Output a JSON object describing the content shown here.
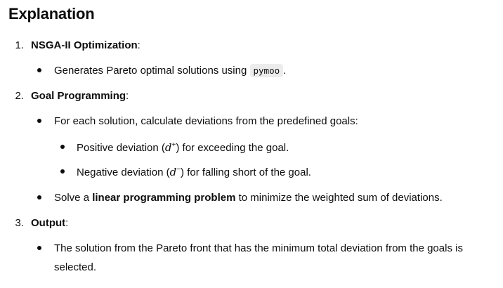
{
  "heading": "Explanation",
  "list": {
    "items": [
      {
        "number": "1.",
        "title": "NSGA-II Optimization",
        "suffix": ":",
        "bullets": [
          {
            "text_before": "Generates Pareto optimal solutions using",
            "code": "pymoo",
            "text_after": "."
          }
        ]
      },
      {
        "number": "2.",
        "title": "Goal Programming",
        "suffix": ":",
        "bullets": [
          {
            "text": "For each solution, calculate deviations from the predefined goals:"
          },
          {
            "text_before": "Solve a",
            "bold": "linear programming problem",
            "text_after": "to minimize the weighted sum of deviations."
          }
        ],
        "sub_bullets": [
          {
            "text_before": "Positive deviation (",
            "math_var": "d",
            "math_sup": "+",
            "text_after": ") for exceeding the goal."
          },
          {
            "text_before": "Negative deviation (",
            "math_var": "d",
            "math_sup": "−",
            "text_after": ") for falling short of the goal."
          }
        ]
      },
      {
        "number": "3.",
        "title": "Output",
        "suffix": ":",
        "bullets": [
          {
            "line1": "The solution from the Pareto front that has the minimum total deviation from the goals is",
            "line2": "selected."
          }
        ]
      }
    ]
  }
}
